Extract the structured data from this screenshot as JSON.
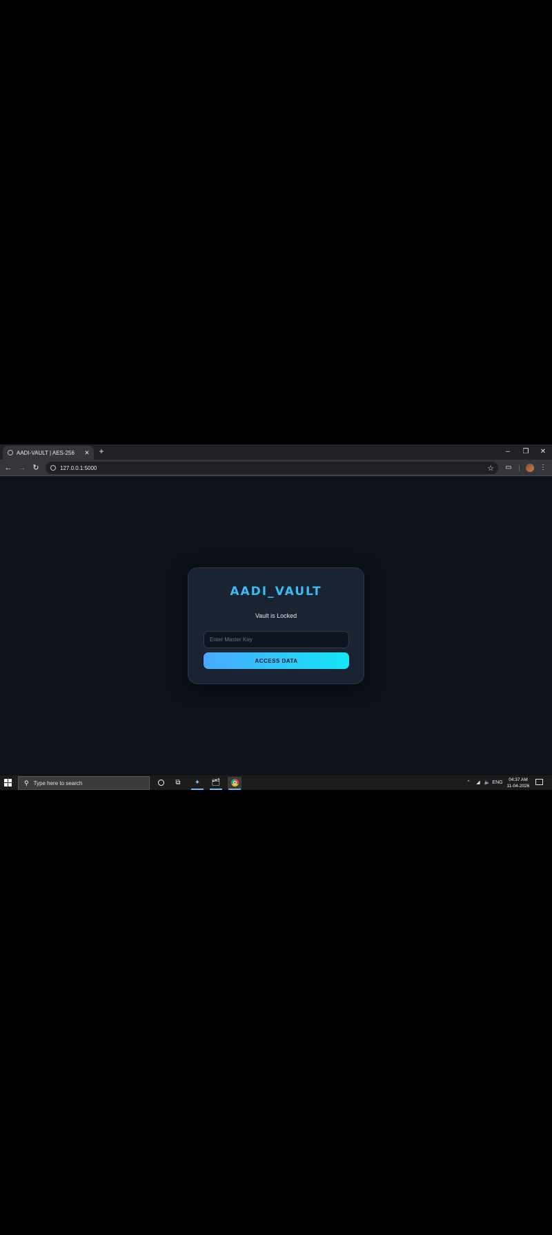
{
  "browser": {
    "tab": {
      "title": "AADI-VAULT | AES-256"
    },
    "new_tab_symbol": "+",
    "url": "127.0.0.1:5000"
  },
  "vault": {
    "title": "AADI_VAULT",
    "status": "Vault is Locked",
    "input_placeholder": "Enter Master Key",
    "input_value": "",
    "button_label": "ACCESS DATA"
  },
  "taskbar": {
    "search_placeholder": "Type here to search",
    "language": "ENG",
    "time": "04:37 AM",
    "date": "11-04-2026"
  },
  "colors": {
    "accent": "#38bdf8",
    "button_gradient_start": "#4aa8ff",
    "button_gradient_end": "#14e6f6",
    "page_background": "#0d1119",
    "card_background": "#1a2332"
  }
}
